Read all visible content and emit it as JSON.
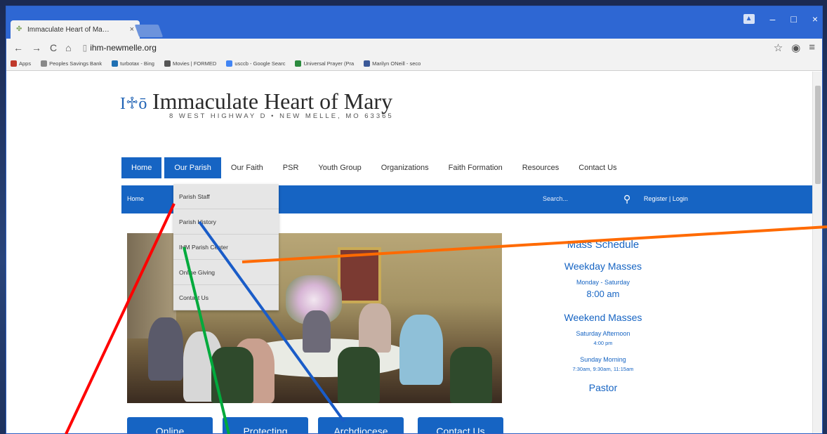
{
  "browser": {
    "tab_title": "Immaculate Heart of Ma…",
    "tab_close": "×",
    "url": "ihm-newmelle.org",
    "win_user": "▲",
    "win_min": "–",
    "win_max": "□",
    "win_close": "×",
    "bookmarks": [
      {
        "label": "Apps",
        "color": "#c0392b"
      },
      {
        "label": "Peoples Savings Bank",
        "color": "#888888"
      },
      {
        "label": "turbotax - Bing",
        "color": "#1f6fb2"
      },
      {
        "label": "Movies | FORMED",
        "color": "#555555"
      },
      {
        "label": "usccb - Google Searc",
        "color": "#4285f4"
      },
      {
        "label": "Universal Prayer (Pra",
        "color": "#2b8a3e"
      },
      {
        "label": "Marilyn ONeill - seco",
        "color": "#3b5998"
      }
    ]
  },
  "site": {
    "logo_text": "I♱ō",
    "title": "Immaculate Heart of Mary",
    "address": "8 WEST HIGHWAY D • NEW MELLE, MO 63365",
    "nav": [
      "Home",
      "Our Parish",
      "Our Faith",
      "PSR",
      "Youth Group",
      "Organizations",
      "Faith Formation",
      "Resources",
      "Contact Us"
    ],
    "breadcrumb": "Home",
    "search_placeholder": "Search...",
    "register_login": "Register  |  Login",
    "dropdown": [
      "Parish Staff",
      "Parish History",
      "IHM Parish Center",
      "Online Giving",
      "Contact Us"
    ],
    "buttons": [
      "Online",
      "Protecting",
      "Archdiocese",
      "Contact Us"
    ],
    "mass": {
      "heading": "Mass Schedule",
      "weekday": "Weekday Masses",
      "weekday_days": "Monday - Saturday",
      "weekday_time": "8:00 am",
      "weekend": "Weekend Masses",
      "sat_label": "Saturday Afternoon",
      "sat_time": "4:00 pm",
      "sun_label": "Sunday Morning",
      "sun_times": "7:30am, 9:30am, 11:15am",
      "pastor": "Pastor"
    }
  },
  "colors": {
    "primary_blue": "#1664c3",
    "annotation_red": "#ff0000",
    "annotation_green": "#00aa3c",
    "annotation_blue": "#1a5cc8",
    "annotation_orange": "#ff6a00"
  }
}
